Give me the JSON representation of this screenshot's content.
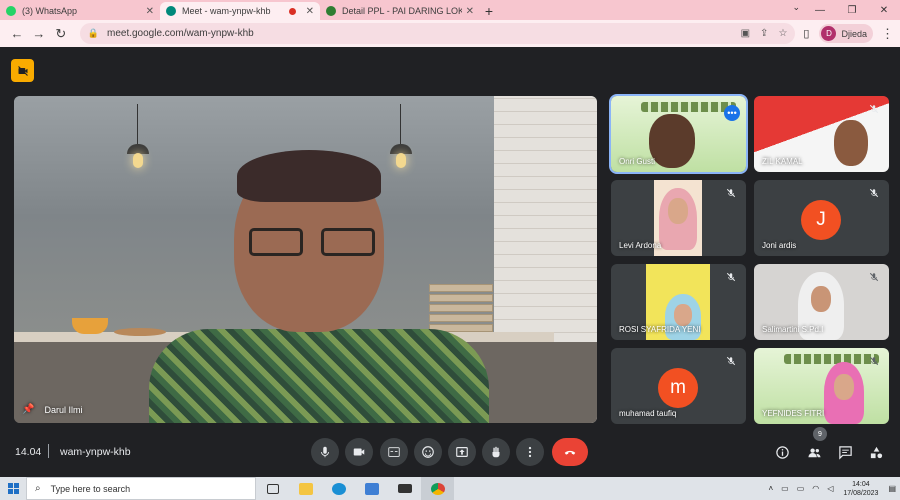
{
  "browser": {
    "tabs": [
      {
        "title": "(3) WhatsApp",
        "active": false,
        "favicon_color": "#25d366"
      },
      {
        "title": "Meet - wam-ynpw-khb",
        "active": true,
        "favicon_color": "#00897b",
        "recording": true
      },
      {
        "title": "Detail PPL - PAI DARING LOKAKA",
        "active": false,
        "favicon_color": "#2e7d32"
      }
    ],
    "url": "meet.google.com/wam-ynpw-khb",
    "profile_initial": "D",
    "profile_name": "Djieda"
  },
  "meet": {
    "main_speaker": "Darul Ilmi",
    "tiles": [
      {
        "name": "Onri Gusti",
        "speaking": true,
        "muted": false
      },
      {
        "name": "ZIL KAMAL",
        "muted": true
      },
      {
        "name": "Levi Ardona",
        "muted": true
      },
      {
        "name": "Joni ardis",
        "muted": true,
        "avatar_letter": "J"
      },
      {
        "name": "ROSI SYAFRIDA YENI",
        "muted": true
      },
      {
        "name": "Salimartini S.Pd.I",
        "muted": true
      },
      {
        "name": "muhamad taufiq",
        "muted": true,
        "avatar_letter": "m"
      },
      {
        "name": "YEFNIDES FITRI",
        "muted": true
      }
    ],
    "time": "14.04",
    "meeting_code": "wam-ynpw-khb",
    "participant_count": "9",
    "colors": {
      "end_call": "#ea4335",
      "accent": "#8ab4f8",
      "avatar": "#f25022",
      "badge": "#f9ab00"
    }
  },
  "taskbar": {
    "search_placeholder": "Type here to search",
    "time": "14:04",
    "date": "17/08/2023"
  }
}
